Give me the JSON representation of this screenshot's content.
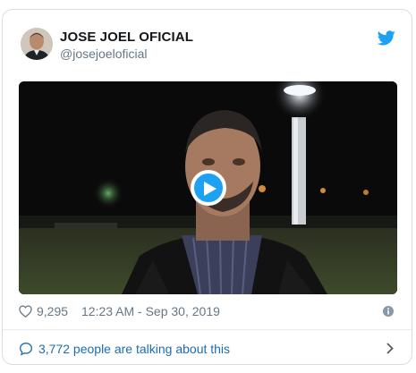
{
  "tweet": {
    "display_name": "JOSE JOEL OFICIAL",
    "handle": "@josejoeloficial",
    "likes": "9,295",
    "timestamp": "12:23 AM - Sep 30, 2019",
    "talking_text": "3,772 people are talking about this"
  },
  "icons": {
    "brand": "twitter-bird-icon",
    "play": "play-icon",
    "like": "heart-icon",
    "info": "info-icon",
    "talking": "speech-bubble-icon",
    "chevron": "chevron-right-icon"
  },
  "colors": {
    "brand_blue": "#1da1f2",
    "link_blue": "#1b6cb3",
    "muted_text": "#657786",
    "name_text": "#14171a"
  }
}
